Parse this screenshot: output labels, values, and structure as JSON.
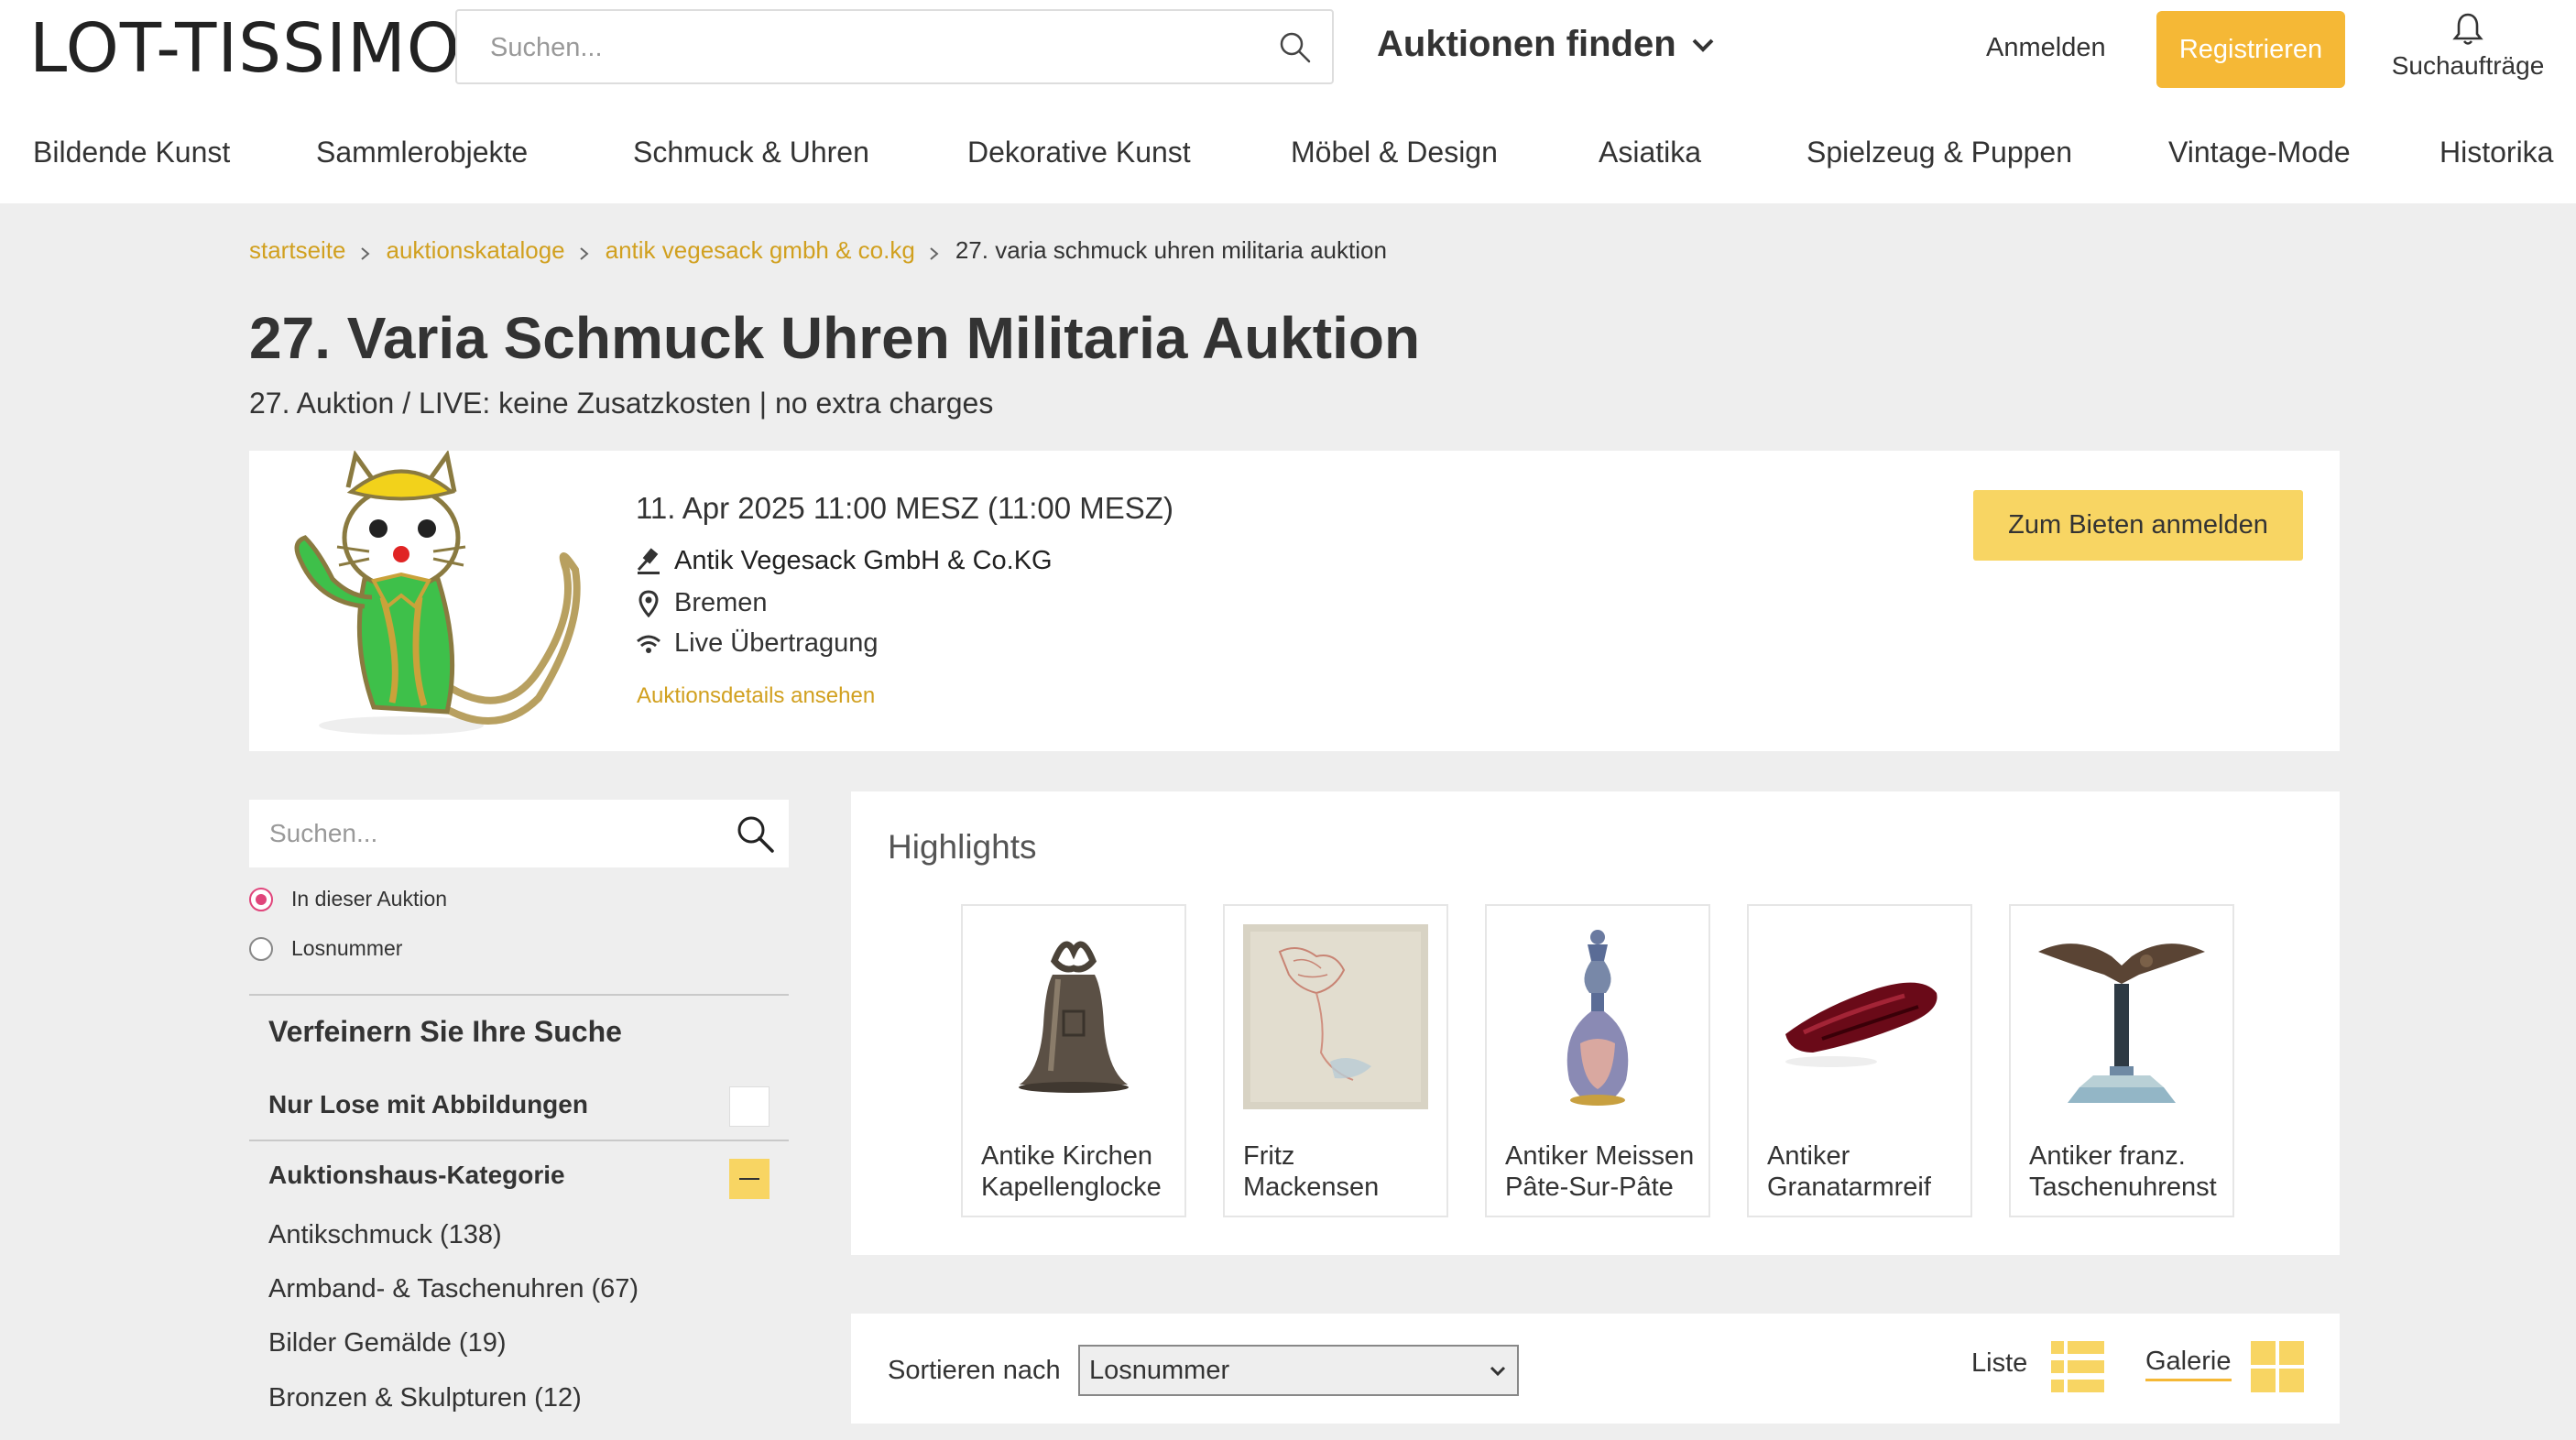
{
  "header": {
    "logo": "LOT-TISSIMO",
    "search_placeholder": "Suchen...",
    "find_auctions": "Auktionen finden",
    "login": "Anmelden",
    "register": "Registrieren",
    "alerts": "Suchaufträge"
  },
  "categories": [
    "Bildende Kunst",
    "Sammlerobjekte",
    "Schmuck & Uhren",
    "Dekorative Kunst",
    "Möbel & Design",
    "Asiatika",
    "Spielzeug & Puppen",
    "Vintage-Mode",
    "Historika"
  ],
  "breadcrumb": {
    "items": [
      "startseite",
      "auktionskataloge",
      "antik vegesack gmbh & co.kg"
    ],
    "current": "27. varia schmuck uhren militaria auktion"
  },
  "auction": {
    "title": "27. Varia Schmuck Uhren Militaria Auktion",
    "subtitle": "27. Auktion / LIVE: keine Zusatzkosten | no extra charges",
    "date": "11. Apr 2025 11:00 MESZ (11:00 MESZ)",
    "house": "Antik Vegesack GmbH & Co.KG",
    "location": "Bremen",
    "live": "Live Übertragung",
    "details_link": "Auktionsdetails ansehen",
    "bid_button": "Zum Bieten anmelden"
  },
  "sidebar": {
    "search_placeholder": "Suchen...",
    "radio_options": [
      "In dieser Auktion",
      "Losnummer"
    ],
    "selected_radio": "In dieser Auktion",
    "refine_title": "Verfeinern Sie Ihre Suche",
    "images_only": "Nur Lose mit Abbildungen",
    "category_heading": "Auktionshaus-Kategorie",
    "category_items": [
      "Antikschmuck (138)",
      "Armband- & Taschenuhren (67)",
      "Bilder Gemälde (19)",
      "Bronzen & Skulpturen (12)"
    ]
  },
  "highlights": {
    "title": "Highlights",
    "items": [
      {
        "label": "Antike Kirchen Kapellenglocke",
        "icon": "bell-image"
      },
      {
        "label": "Fritz Mackensen",
        "icon": "drawing-image"
      },
      {
        "label": "Antiker Meissen Pâte-Sur-Pâte",
        "icon": "vase-image"
      },
      {
        "label": "Antiker Granatarmreif",
        "icon": "bracelet-image"
      },
      {
        "label": "Antiker franz. Taschenuhrenst",
        "icon": "eagle-stand-image"
      }
    ]
  },
  "sort": {
    "label": "Sortieren nach",
    "selected": "Losnummer",
    "view_list": "Liste",
    "view_gallery": "Galerie",
    "active_view": "Galerie"
  },
  "colors": {
    "accent_orange": "#f5b836",
    "accent_yellow": "#f8d563",
    "link_gold": "#d1a01f",
    "radio_pink": "#e0457b"
  }
}
